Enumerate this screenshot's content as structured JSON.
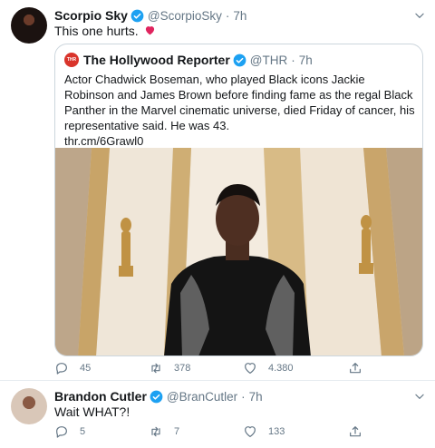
{
  "tweets": [
    {
      "name": "Scorpio Sky",
      "handle": "@ScorpioSky",
      "separator": "·",
      "time": "7h",
      "text": "This one hurts.",
      "quote": {
        "name": "The Hollywood Reporter",
        "logo_text": "THR",
        "handle": "@THR",
        "separator": "·",
        "time": "7h",
        "text": "Actor Chadwick Boseman, who played Black icons Jackie Robinson and James Brown before finding fame as the regal Black Panther in the Marvel cinematic universe, died Friday of cancer, his representative said. He was 43.",
        "link": "thr.cm/6Grawl0"
      },
      "actions": {
        "replies": "45",
        "retweets": "378",
        "likes": "4.380"
      }
    },
    {
      "name": "Brandon Cutler",
      "handle": "@BranCutler",
      "separator": "·",
      "time": "7h",
      "text": "Wait WHAT?!",
      "actions": {
        "replies": "5",
        "retweets": "7",
        "likes": "133"
      }
    }
  ],
  "colors": {
    "verified": "#1da1f2",
    "secondary_text": "#657786",
    "border": "#ccd6dd",
    "broken_heart": "#e0245e",
    "thr_logo": "#d9342b"
  },
  "icons": [
    "verified-badge-icon",
    "chevron-down-icon",
    "broken-heart-icon",
    "reply-icon",
    "retweet-icon",
    "like-icon",
    "share-icon"
  ]
}
